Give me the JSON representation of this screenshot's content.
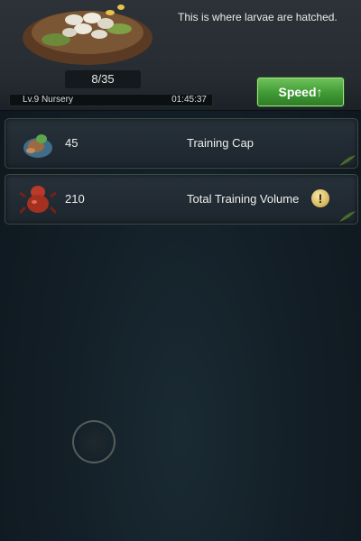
{
  "header": {
    "description": "This is where larvae are hatched.",
    "larvae_count": "8/35",
    "level_label": "Lv.9 Nursery",
    "timer": "01:45:37",
    "speed_button": "Speed↑"
  },
  "stats": [
    {
      "value": "45",
      "label": "Training Cap",
      "icon": "larva-icon"
    },
    {
      "value": "210",
      "label": "Total Training Volume",
      "icon": "soldier-ant-icon"
    }
  ],
  "colors": {
    "accent_green": "#4fa83f",
    "info_gold": "#d4b45a",
    "background": "#121d25"
  }
}
